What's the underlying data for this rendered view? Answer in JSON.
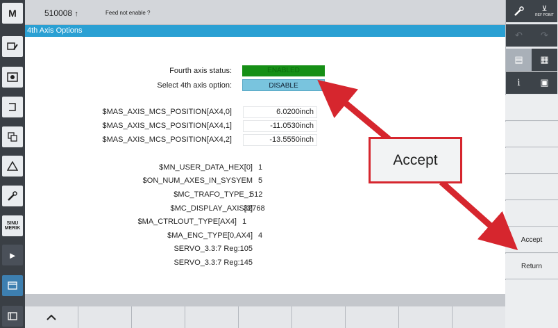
{
  "header": {
    "alarm_number": "510008",
    "alarm_text": "Feed not enable ?"
  },
  "title": "4th Axis Options",
  "axis_status": {
    "status_label": "Fourth axis status:",
    "status_value": "ENABLED",
    "option_label": "Select 4th axis option:",
    "option_value": "DISABLE"
  },
  "positions": [
    {
      "label": "$MAS_AXIS_MCS_POSITION[AX4,0]",
      "value": "6.0200inch"
    },
    {
      "label": "$MAS_AXIS_MCS_POSITION[AX4,1]",
      "value": "-11.0530inch"
    },
    {
      "label": "$MAS_AXIS_MCS_POSITION[AX4,2]",
      "value": "-13.5550inch"
    }
  ],
  "params": [
    {
      "label": "$MN_USER_DATA_HEX[0]",
      "value": "1"
    },
    {
      "label": "$ON_NUM_AXES_IN_SYSYEM",
      "value": "5"
    },
    {
      "label": "$MC_TRAFO_TYPE_1",
      "value": "512"
    },
    {
      "label": "$MC_DISPLAY_AXIS[3]",
      "value": "32768"
    },
    {
      "label": "$MA_CTRLOUT_TYPE[AX4]",
      "value": "1"
    },
    {
      "label": "$MA_ENC_TYPE[0,AX4]",
      "value": "4"
    },
    {
      "label": "SERVO_3.3:7 Reg:105",
      "value": ""
    },
    {
      "label": "SERVO_3.3:7 Reg:145",
      "value": ""
    }
  ],
  "annotation": {
    "text": "Accept",
    "color": "#d6262e"
  },
  "softkeys": {
    "accept": "Accept",
    "return": "Return"
  },
  "right_top": {
    "ref_point": "REF POINT"
  },
  "colors": {
    "title_bar": "#2aa0d3",
    "enabled": "#168f16",
    "disable": "#79c4de"
  }
}
